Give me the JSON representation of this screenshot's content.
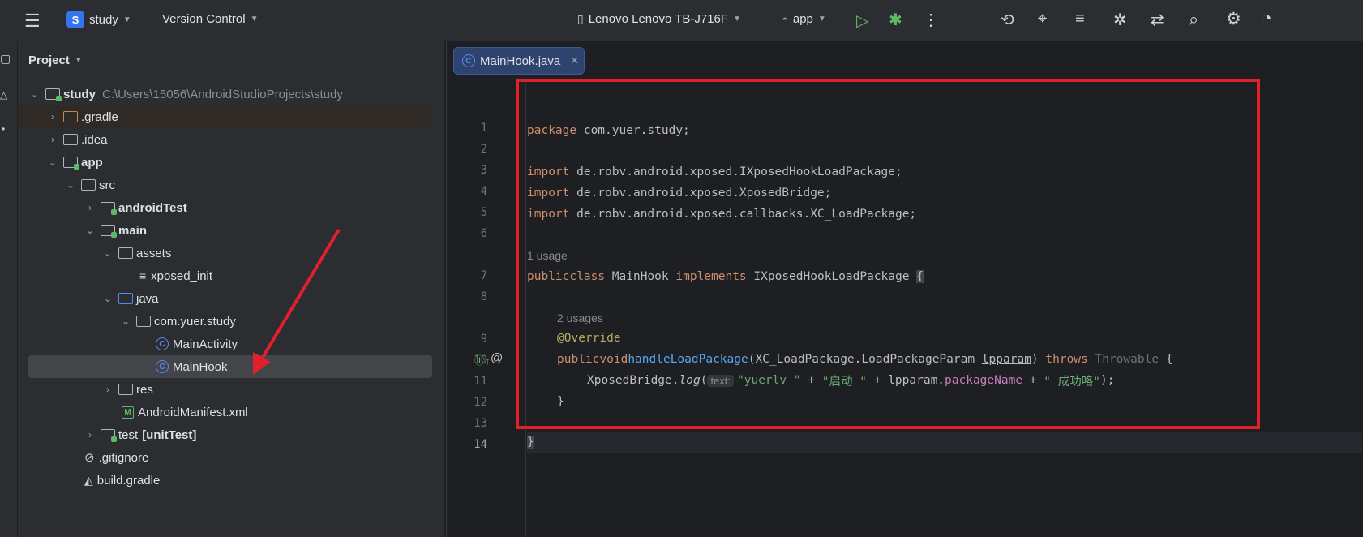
{
  "toolbar": {
    "project_initial": "S",
    "project_name": "study",
    "vcs": "Version Control",
    "device": "Lenovo Lenovo TB-J716F",
    "run_config": "app"
  },
  "project_panel": {
    "title": "Project",
    "tree": [
      {
        "label": "study",
        "path": "C:\\Users\\15056\\AndroidStudioProjects\\study"
      },
      {
        "label": ".gradle"
      },
      {
        "label": ".idea"
      },
      {
        "label": "app"
      },
      {
        "label": "src"
      },
      {
        "label": "androidTest"
      },
      {
        "label": "main"
      },
      {
        "label": "assets"
      },
      {
        "label": "xposed_init"
      },
      {
        "label": "java"
      },
      {
        "label": "com.yuer.study"
      },
      {
        "label": "MainActivity"
      },
      {
        "label": "MainHook"
      },
      {
        "label": "res"
      },
      {
        "label": "AndroidManifest.xml"
      },
      {
        "label": "test",
        "suffix": "[unitTest]"
      },
      {
        "label": ".gitignore"
      },
      {
        "label": "build.gradle"
      }
    ]
  },
  "editor": {
    "tab_label": "MainHook.java",
    "tab_icon": "C",
    "line_numbers": [
      "1",
      "2",
      "3",
      "4",
      "5",
      "6",
      "7",
      "8",
      "9",
      "10",
      "11",
      "12",
      "13",
      "14"
    ],
    "code": {
      "l1_kw": "package",
      "l1_rest": " com.yuer.study;",
      "l3_kw": "import",
      "l3_rest": " de.robv.android.xposed.IXposedHookLoadPackage;",
      "l4_kw": "import",
      "l4_rest": " de.robv.android.xposed.XposedBridge;",
      "l5_kw": "import",
      "l5_rest": " de.robv.android.xposed.callbacks.XC_LoadPackage;",
      "usage_hint_1": "1 usage",
      "l7_kw1": "public",
      "l7_kw2": "class",
      "l7_name": " MainHook ",
      "l7_kw3": "implements",
      "l7_iface": " IXposedHookLoadPackage ",
      "l7_brace": "{",
      "usage_hint_2": "2 usages",
      "l9_ann": "@Override",
      "l10_kw1": "public",
      "l10_kw2": "void",
      "l10_fn": "handleLoadPackage",
      "l10_params": "(XC_LoadPackage.LoadPackageParam ",
      "l10_param_name": "lpparam",
      "l10_close": ") ",
      "l10_throws": "throws",
      "l10_throwable": " Throwable",
      "l10_brace": " {",
      "l11_obj": "XposedBridge.",
      "l11_method": "log",
      "l11_open": "(",
      "l11_hint": "text:",
      "l11_str1": "\"yuerlv \"",
      "l11_plus1": " + ",
      "l11_str2": "\"启动 \"",
      "l11_plus2": " + lpparam.",
      "l11_field": "packageName",
      "l11_plus3": " + ",
      "l11_str3": "\" 成功咯\"",
      "l11_end": ");",
      "l12": "}",
      "l14": "}"
    }
  }
}
